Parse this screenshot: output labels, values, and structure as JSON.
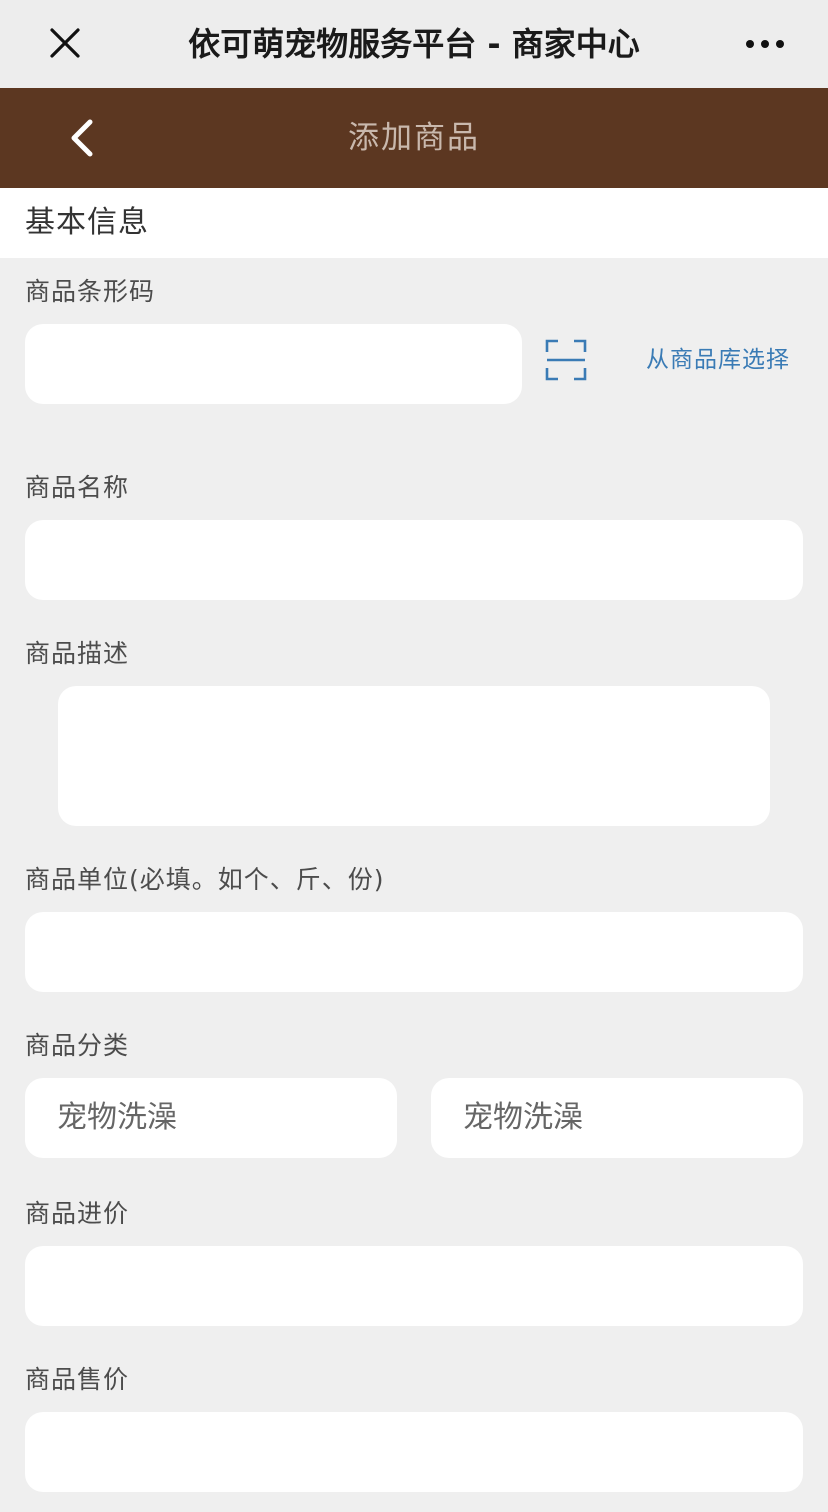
{
  "window": {
    "title": "依可萌宠物服务平台 - 商家中心",
    "close_icon": "close-icon",
    "more_icon": "more-dots-icon"
  },
  "navbar": {
    "title": "添加商品",
    "back_icon": "chevron-left-icon",
    "bg_color": "#5c3721"
  },
  "section": {
    "title": "基本信息"
  },
  "form": {
    "barcode": {
      "label": "商品条形码",
      "value": "",
      "scan_icon": "scan-icon",
      "library_link": "从商品库选择"
    },
    "name": {
      "label": "商品名称",
      "value": ""
    },
    "description": {
      "label": "商品描述",
      "value": ""
    },
    "unit": {
      "label": "商品单位(必填。如个、斤、份)",
      "value": ""
    },
    "category": {
      "label": "商品分类",
      "primary": "宠物洗澡",
      "secondary": "宠物洗澡"
    },
    "cost_price": {
      "label": "商品进价",
      "value": ""
    },
    "sale_price": {
      "label": "商品售价",
      "value": ""
    }
  },
  "colors": {
    "link": "#3a7bb5",
    "page_bg": "#efefef"
  }
}
